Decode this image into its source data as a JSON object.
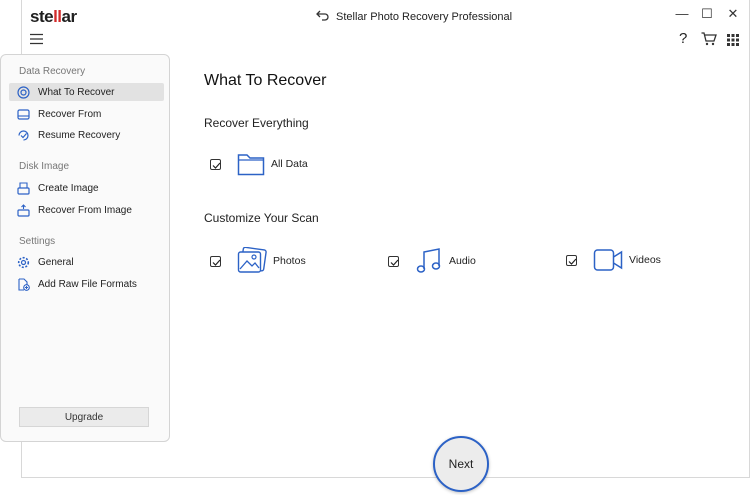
{
  "app": {
    "logo_text_prefix": "ste",
    "logo_text_ll": "ll",
    "logo_text_suffix": "ar",
    "window_title": "Stellar Photo Recovery Professional",
    "window_controls": [
      "—",
      "☐",
      "✕"
    ]
  },
  "toolbar": {
    "icons": [
      "menu-icon",
      "help-icon",
      "cart-icon",
      "apps-grid-icon"
    ],
    "help_glyph": "?"
  },
  "sidebar": {
    "sections": [
      {
        "title": "Data Recovery",
        "items": [
          {
            "label": "What To Recover",
            "icon": "target-icon",
            "active": true
          },
          {
            "label": "Recover From",
            "icon": "drive-icon",
            "active": false
          },
          {
            "label": "Resume Recovery",
            "icon": "resume-icon",
            "active": false
          }
        ]
      },
      {
        "title": "Disk Image",
        "items": [
          {
            "label": "Create Image",
            "icon": "create-image-icon",
            "active": false
          },
          {
            "label": "Recover From Image",
            "icon": "recover-image-icon",
            "active": false
          }
        ]
      },
      {
        "title": "Settings",
        "items": [
          {
            "label": "General",
            "icon": "gear-icon",
            "active": false
          },
          {
            "label": "Add Raw File Formats",
            "icon": "add-file-icon",
            "active": false
          }
        ]
      }
    ],
    "upgrade_label": "Upgrade"
  },
  "main": {
    "title": "What To Recover",
    "recover_everything": {
      "heading": "Recover Everything",
      "options": [
        {
          "label": "All Data",
          "checked": true,
          "icon": "folder-icon"
        }
      ]
    },
    "customize": {
      "heading": "Customize Your Scan",
      "options": [
        {
          "label": "Photos",
          "checked": true,
          "icon": "photos-icon"
        },
        {
          "label": "Audio",
          "checked": true,
          "icon": "music-note-icon"
        },
        {
          "label": "Videos",
          "checked": true,
          "icon": "video-camera-icon"
        }
      ]
    }
  },
  "footer": {
    "next_label": "Next"
  },
  "colors": {
    "accent": "#2c62c6",
    "logo_accent": "#d22a2a",
    "active_item_bg": "#e2e2e2"
  }
}
